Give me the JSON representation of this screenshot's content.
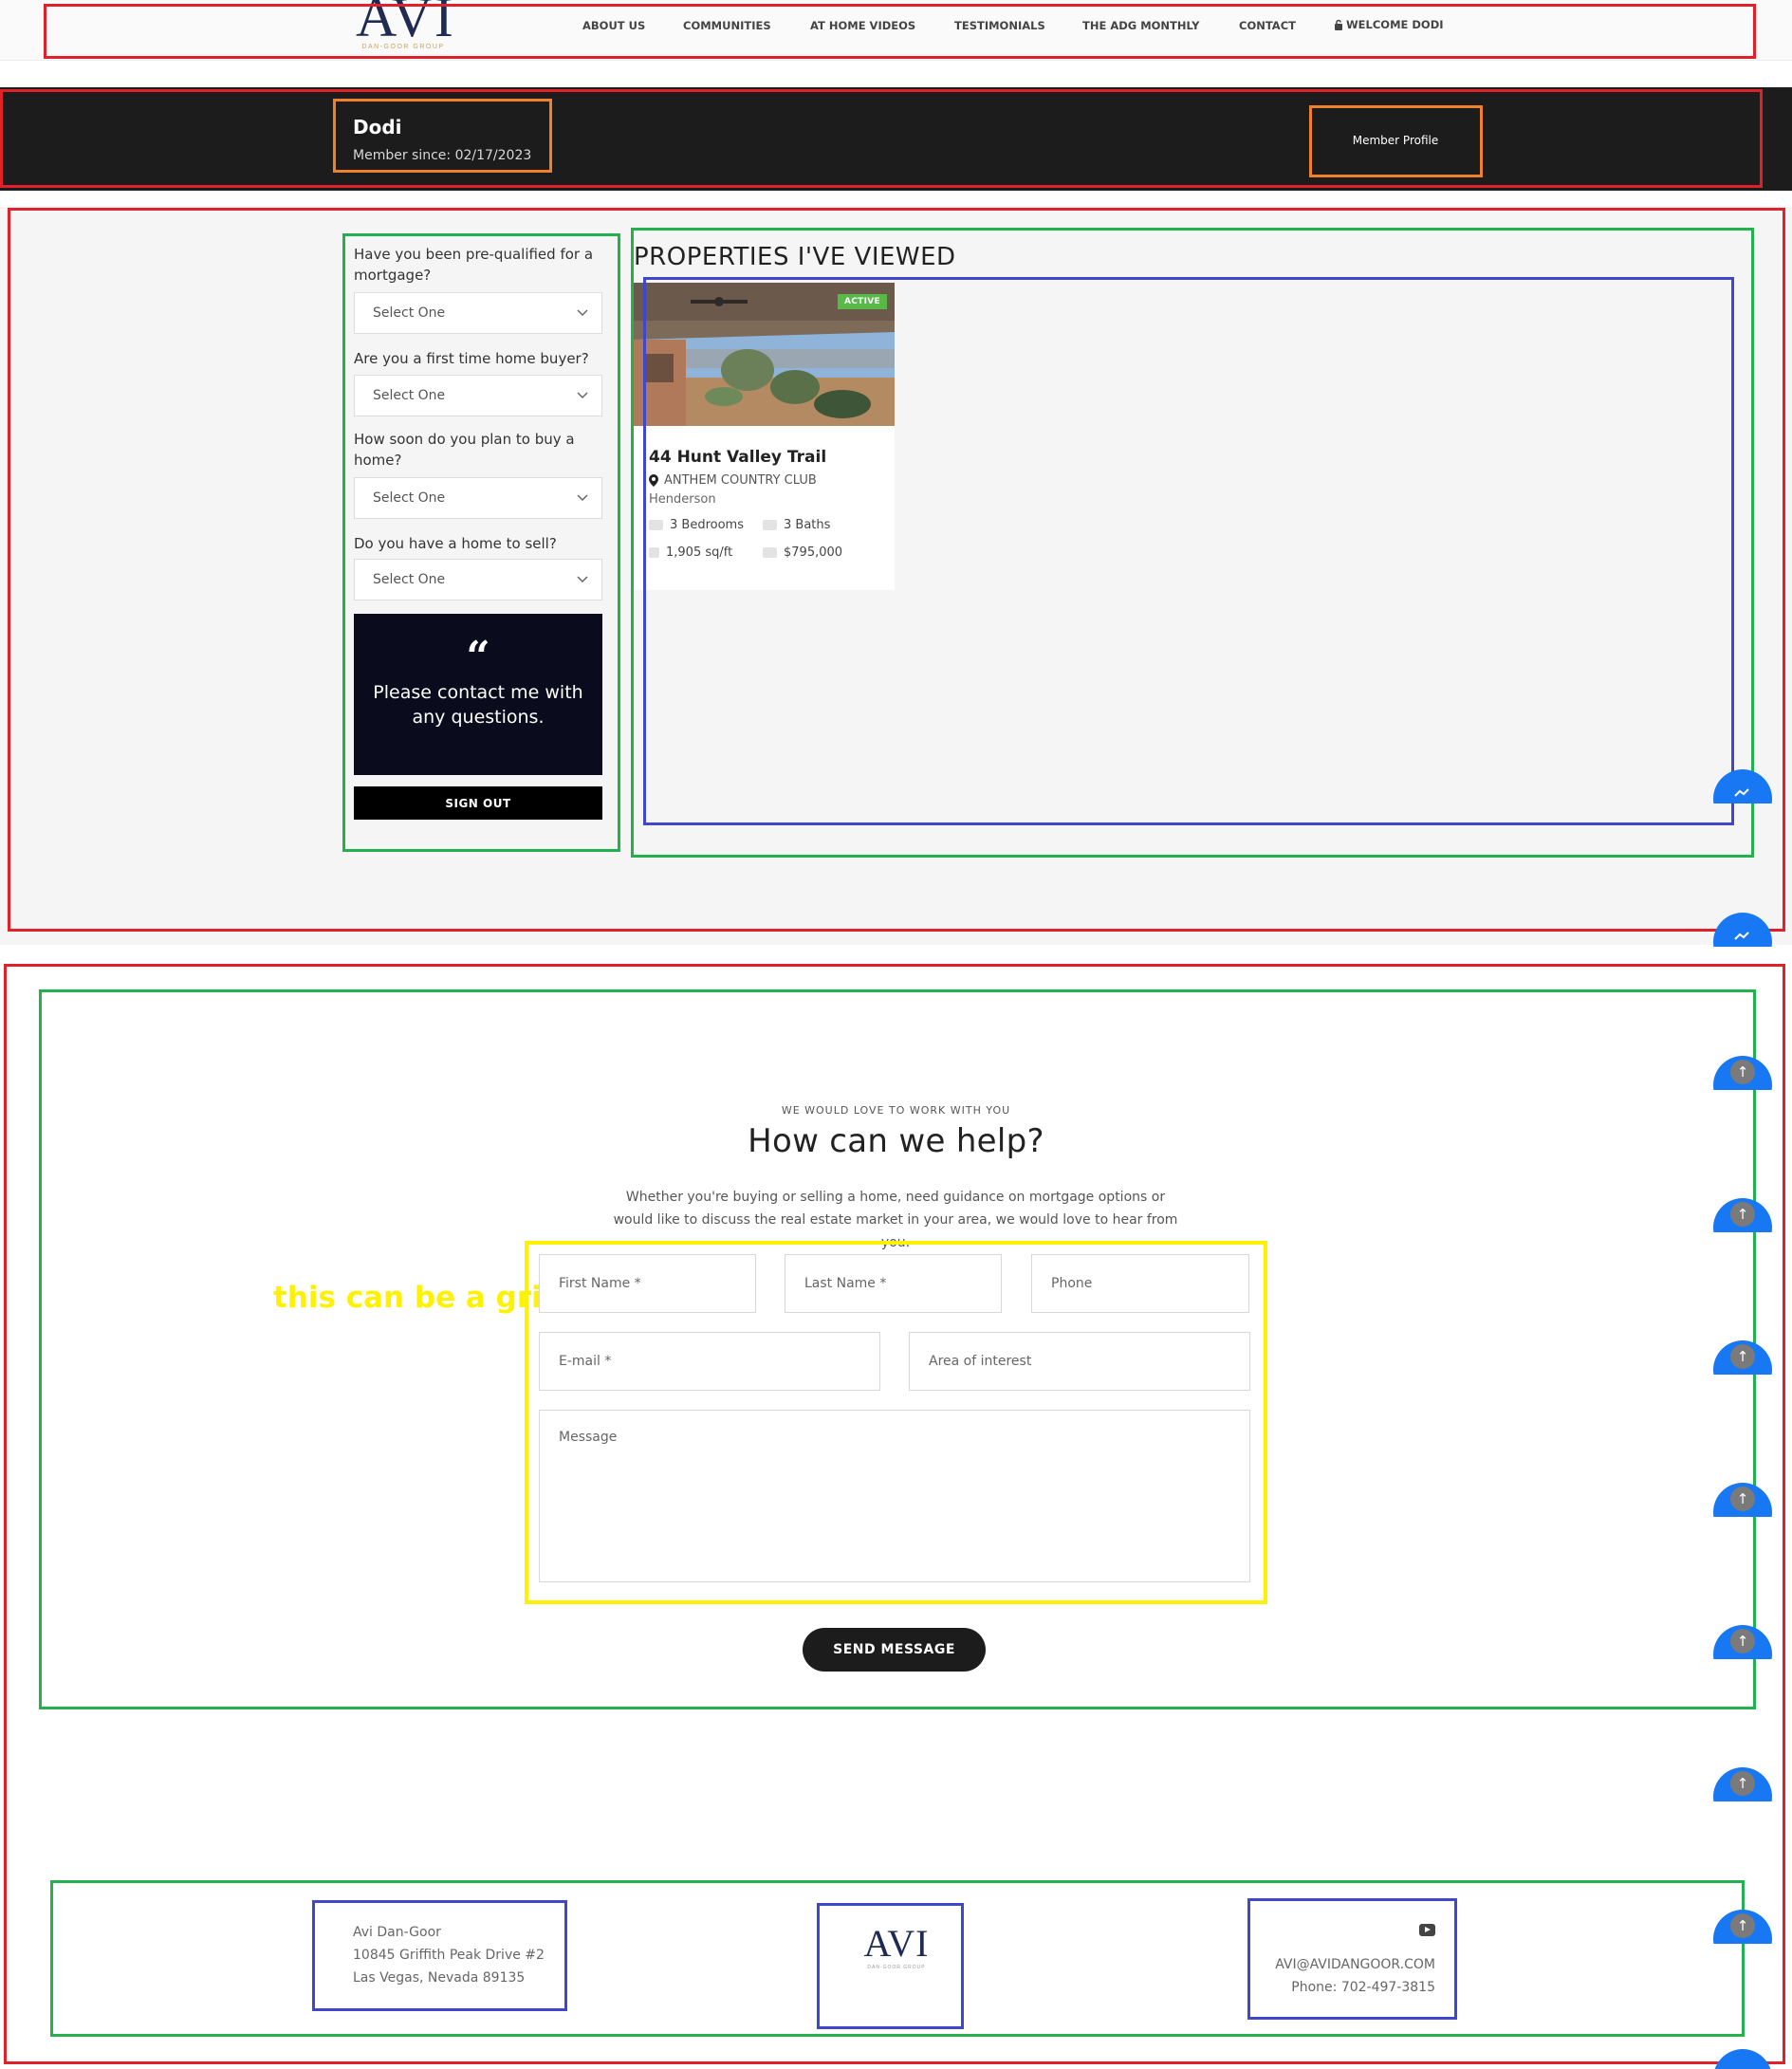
{
  "header": {
    "logo_text": "AVI",
    "logo_sub": "DAN-GOOR GROUP",
    "nav": [
      "ABOUT US",
      "COMMUNITIES",
      "AT HOME VIDEOS",
      "TESTIMONIALS",
      "THE ADG MONTHLY",
      "CONTACT",
      "WELCOME DODI"
    ]
  },
  "member": {
    "name": "Dodi",
    "since": "Member since: 02/17/2023",
    "profile_label": "Member Profile"
  },
  "questions": [
    {
      "label": "Have you been pre-qualified for a mortgage?",
      "value": "Select One"
    },
    {
      "label": "Are you a first time home buyer?",
      "value": "Select One"
    },
    {
      "label": "How soon do you plan to buy a home?",
      "value": "Select One"
    },
    {
      "label": "Do you have a home to sell?",
      "value": "Select One"
    }
  ],
  "quote": {
    "text": "Please contact me with any questions."
  },
  "signout_label": "SIGN OUT",
  "properties": {
    "title": "PROPERTIES I'VE VIEWED",
    "items": [
      {
        "badge": "ACTIVE",
        "name": "44 Hunt Valley Trail",
        "community": "ANTHEM COUNTRY CLUB",
        "city": "Henderson",
        "bedrooms": "3 Bedrooms",
        "baths": "3 Baths",
        "sqft": "1,905 sq/ft",
        "price": "$795,000"
      }
    ]
  },
  "contact": {
    "eyebrow": "WE WOULD LOVE TO WORK WITH YOU",
    "title": "How can we help?",
    "description": "Whether you're buying or selling a home, need guidance on mortgage options or would like to discuss the real estate market in your area, we would love to hear from you.",
    "annotation": "this can be a grid",
    "fields": {
      "first_name": "First Name *",
      "last_name": "Last Name *",
      "phone": "Phone",
      "email": "E-mail *",
      "area": "Area of interest",
      "message": "Message"
    },
    "send_label": "SEND MESSAGE"
  },
  "footer": {
    "name": "Avi Dan-Goor",
    "street": "10845 Griffith Peak Drive #2",
    "city": "Las Vegas, Nevada 89135",
    "logo_text": "AVI",
    "email": "AVI@AVIDANGOOR.COM",
    "phone": "Phone: 702-497-3815"
  },
  "colors": {
    "annotation_red": "#e0202a",
    "annotation_green": "#22b14c",
    "annotation_orange": "#f0812a",
    "annotation_blue": "#3f48cc",
    "annotation_yellow": "#fff200",
    "messenger_blue": "#1877f2",
    "active_badge": "#58b947"
  }
}
